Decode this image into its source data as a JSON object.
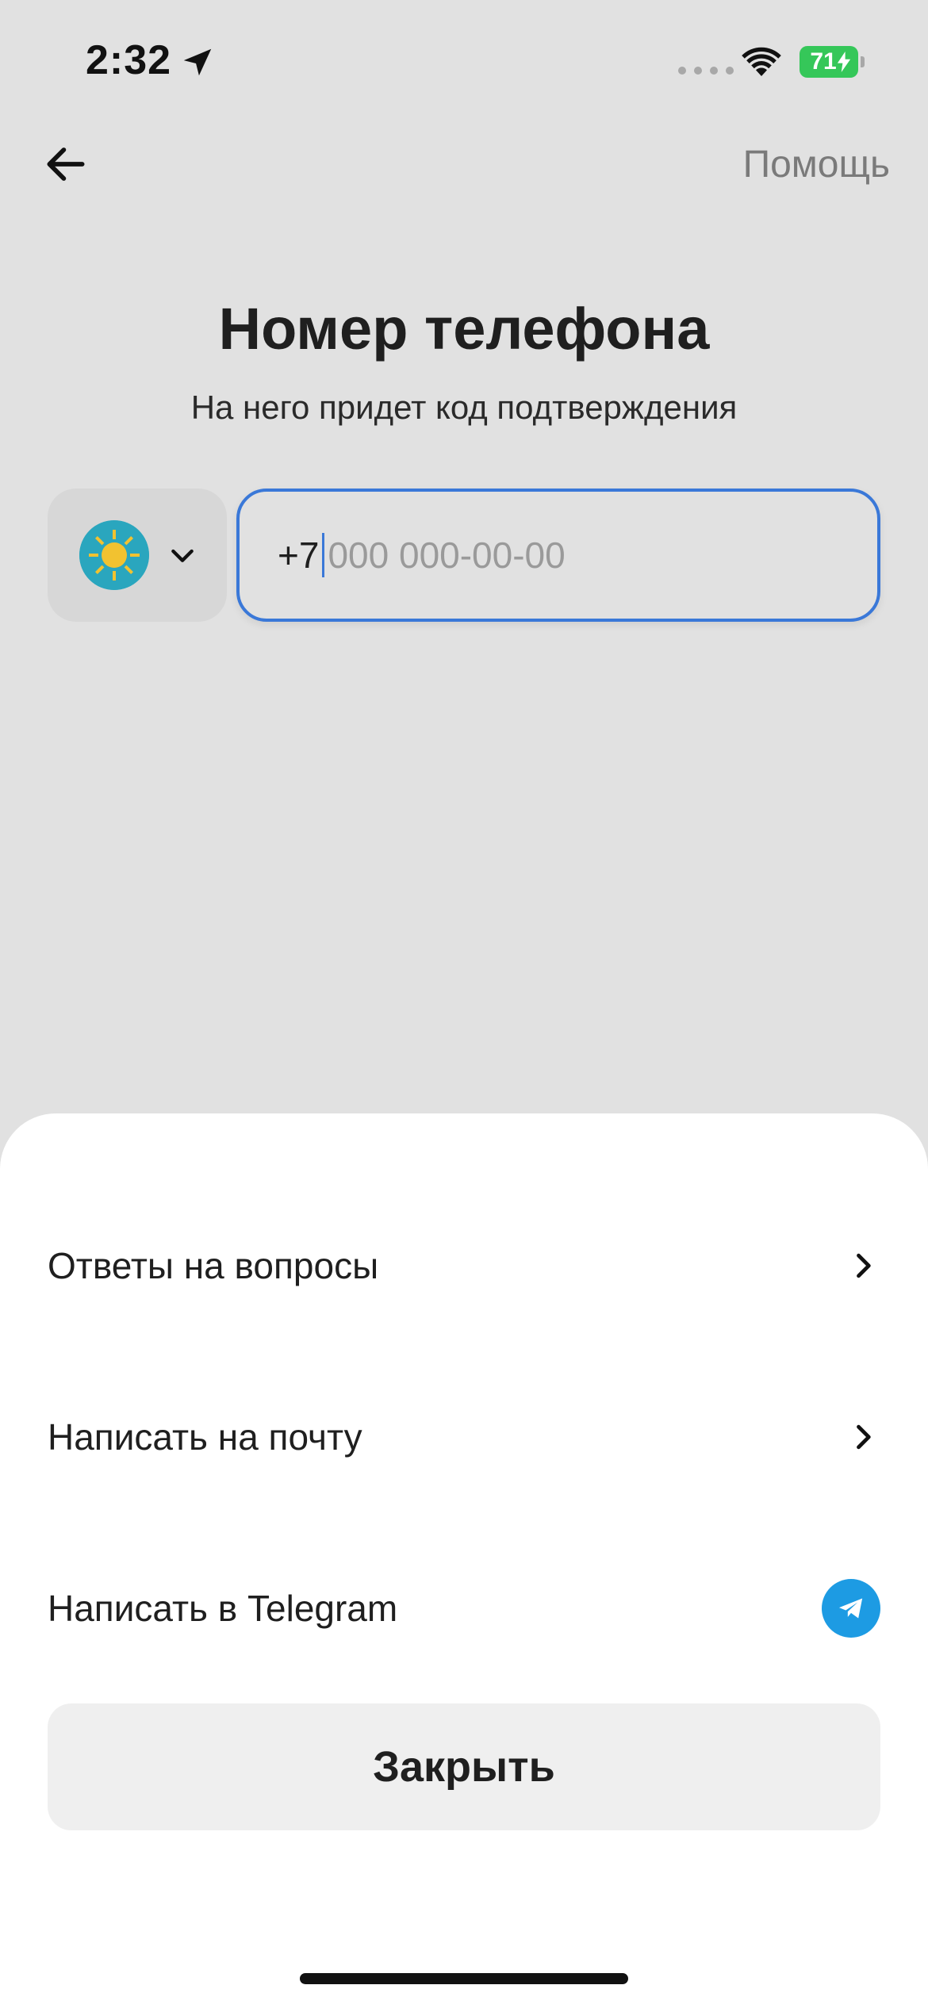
{
  "status_bar": {
    "time": "2:32",
    "battery": "71"
  },
  "nav": {
    "back_icon": "arrow-left-icon",
    "help_label": "Помощь"
  },
  "header": {
    "title": "Номер телефона",
    "subtitle": "На него придет код подтверждения"
  },
  "phone": {
    "country_icon": "kazakhstan-flag-icon",
    "prefix": "+7",
    "placeholder": "000 000-00-00",
    "focus_color": "#3a78d8"
  },
  "help_sheet": {
    "items": [
      {
        "label": "Ответы на вопросы",
        "icon": "chevron-right-icon"
      },
      {
        "label": "Написать на почту",
        "icon": "chevron-right-icon"
      },
      {
        "label": "Написать в Telegram",
        "icon": "telegram-icon"
      }
    ],
    "close_label": "Закрыть"
  },
  "colors": {
    "background": "#e1e1e1",
    "sheet": "#ffffff",
    "telegram": "#1d9be3",
    "battery": "#35c759"
  }
}
